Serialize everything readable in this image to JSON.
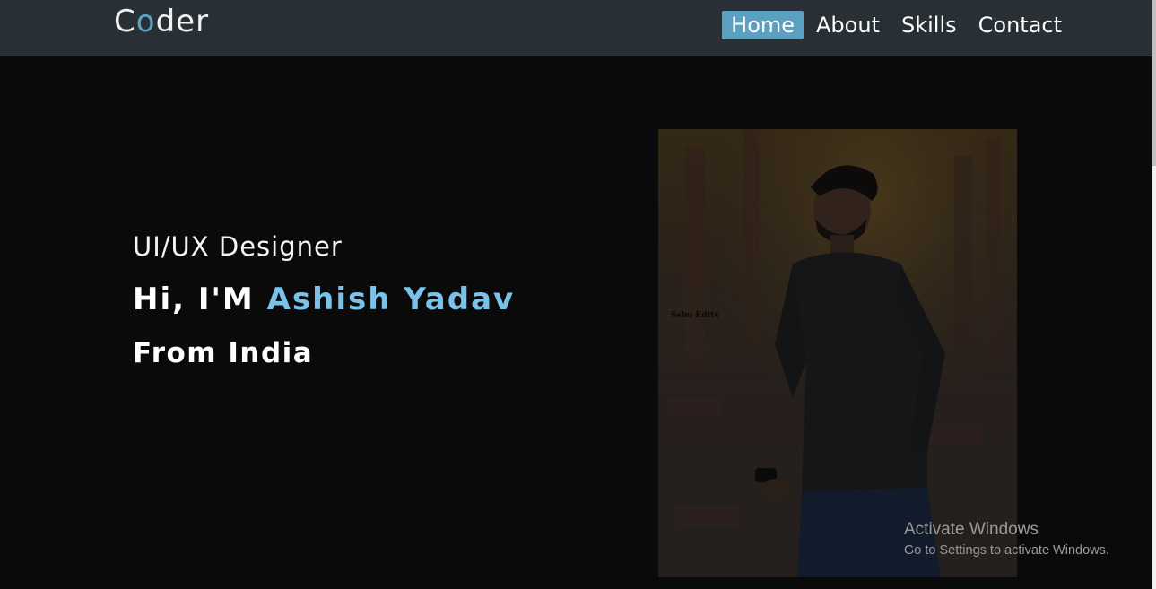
{
  "logo": {
    "first": "C",
    "accent": "o",
    "rest": "der"
  },
  "nav": {
    "items": [
      {
        "label": "Home",
        "active": true
      },
      {
        "label": "About",
        "active": false
      },
      {
        "label": "Skills",
        "active": false
      },
      {
        "label": "Contact",
        "active": false
      }
    ]
  },
  "hero": {
    "role": "UI/UX Designer",
    "greeting": "Hi, I'M ",
    "name": "Ashish Yadav",
    "from": "From India"
  },
  "photo": {
    "watermark": "Ssbu Edits"
  },
  "windows_notice": {
    "title": "Activate Windows",
    "subtitle": "Go to Settings to activate Windows."
  },
  "colors": {
    "background": "#0b0a0b",
    "navbar": "#283036",
    "accent": "#5b9fc1",
    "name_highlight": "#7cc2e8"
  }
}
